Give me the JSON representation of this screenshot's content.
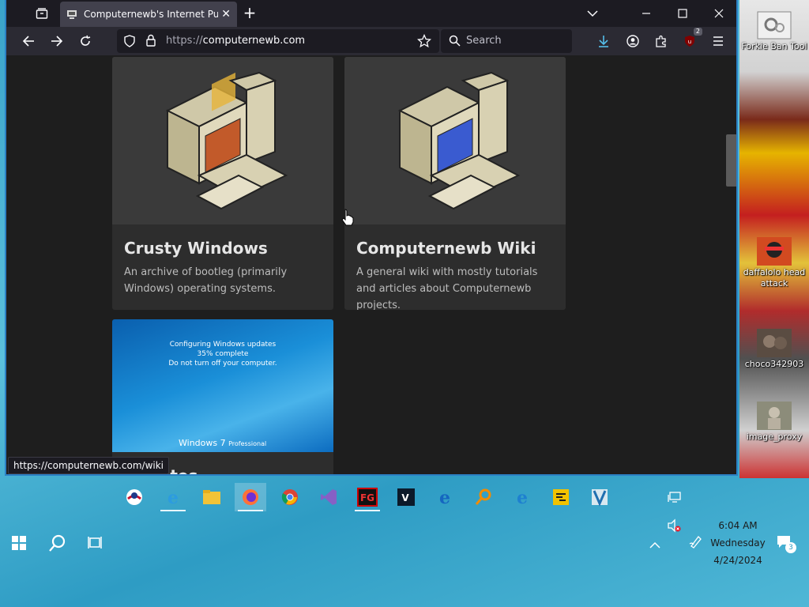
{
  "browser": {
    "tab": {
      "title": "Computernewb's Internet Pub Hub"
    },
    "url": {
      "protocol": "https://",
      "host": "computernewb.com"
    },
    "search": {
      "placeholder": "Search"
    },
    "extension_badge": "2",
    "status_url": "https://computernewb.com/wiki"
  },
  "cards": [
    {
      "title": "Crusty Windows",
      "description": "An archive of bootleg (primarily Windows) operating systems."
    },
    {
      "title": "Computernewb Wiki",
      "description": "A general wiki with mostly tutorials and articles about Computernewb projects."
    },
    {
      "title": "Updates",
      "image_text": {
        "line1": "Configuring Windows updates",
        "line2": "35% complete",
        "line3": "Do not turn off your computer.",
        "logo": "Windows 7",
        "edition": "Professional"
      }
    }
  ],
  "desktop_icons": [
    {
      "label": "Forkie Ban Tool"
    },
    {
      "label": "daffalolo head attack"
    },
    {
      "label": "choco342903"
    },
    {
      "label": "image_proxy"
    }
  ],
  "taskbar_pins": [
    "obama-icon",
    "internet-explorer-icon",
    "file-explorer-icon",
    "firefox-icon",
    "chrome-icon",
    "visual-studio-icon",
    "flashget-icon",
    "vim-icon",
    "ie-blue-icon",
    "magnifier-icon",
    "ie-alt-icon",
    "yellow-app-icon",
    "tool-app-icon"
  ],
  "tray": {
    "time": "6:04 AM",
    "day": "Wednesday",
    "date": "4/24/2024",
    "notifications": "3"
  },
  "colors": {
    "accent": "#2b80c4",
    "browser_bg": "#1c1b22",
    "toolbar_bg": "#2b2a33",
    "card_bg": "#2d2d2d",
    "taskbar_bg": "#3aa3c9"
  }
}
